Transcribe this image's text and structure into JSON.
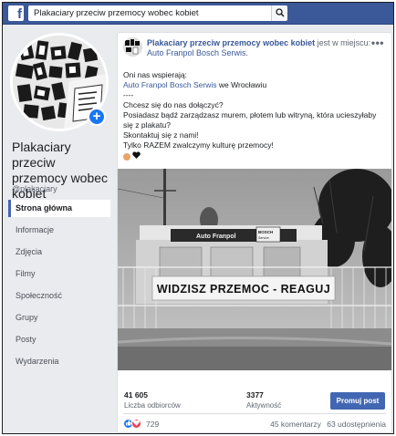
{
  "search": {
    "value": "Plakaciary przeciw przemocy wobec kobiet"
  },
  "sidebar": {
    "page_name": "Plakaciary przeciw przemocy wobec kobiet",
    "handle": "@plakaciary",
    "items": [
      {
        "label": "Strona główna",
        "active": true
      },
      {
        "label": "Informacje"
      },
      {
        "label": "Zdjęcia"
      },
      {
        "label": "Filmy"
      },
      {
        "label": "Społeczność"
      },
      {
        "label": "Grupy"
      },
      {
        "label": "Posty"
      },
      {
        "label": "Wydarzenia"
      }
    ]
  },
  "post": {
    "author": "Plakaciary przeciw przemocy wobec kobiet",
    "location_prefix": "jest w miejscu:",
    "location": "Auto Franpol Bosch Serwis.",
    "lines": [
      "Oni nas wspierają:",
      "Auto Franpol Bosch Serwis",
      "we Wrocławiu",
      "----",
      "Chcesz się do nas dołączyć?",
      "Posiadasz bądź zarządzasz murem, płotem lub witryną, która ucieszyłaby",
      "się z plakatu?",
      "Skontaktuj się z nami!",
      "Tylko RAZEM zwalczymy kulturę przemocy!"
    ],
    "photo": {
      "banner_text": "WIDZISZ PRZEMOC - REAGUJ",
      "sign_text": "Auto Franpol",
      "bosch_text": "BOSCH Service"
    }
  },
  "stats": {
    "followers_value": "41 605",
    "followers_label": "Liczba odbiorców",
    "engagement_value": "3377",
    "engagement_label": "Aktywność",
    "promote_label": "Promuj post"
  },
  "footer": {
    "reactions_count": "729",
    "comments": "45 komentarzy",
    "shares": "63 udostępnienia"
  },
  "colors": {
    "topbar": "#3b5998",
    "link": "#385898",
    "button": "#4267b2",
    "like": "#1877f2",
    "love": "#f33e58"
  }
}
